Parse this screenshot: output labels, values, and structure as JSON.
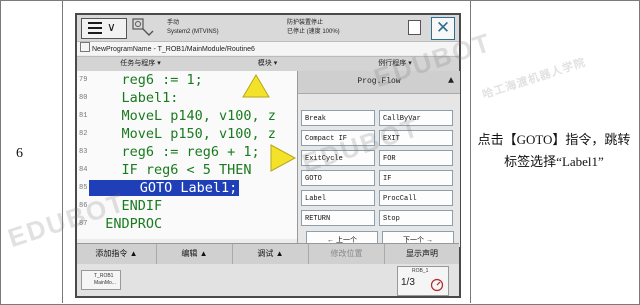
{
  "document": {
    "step_number": "6",
    "description": "点击【GOTO】指令，跳转标签选择“Label1”"
  },
  "pendant": {
    "status": {
      "mode": "手动",
      "system": "System2 (MTVINS)",
      "guard_state": "防护装置停止",
      "run_state": "已停止 (速度 100%)"
    },
    "path": "NewProgramName - T_ROB1/MainModule/Routine6",
    "tabs": [
      "任务与程序",
      "模块",
      "例行程序"
    ],
    "code_lines": [
      {
        "num": "79",
        "text": "    reg6 := 1;"
      },
      {
        "num": "80",
        "text": "    Label1:"
      },
      {
        "num": "81",
        "text": "    MoveL p140, v100, z"
      },
      {
        "num": "82",
        "text": "    MoveL p150, v100, z"
      },
      {
        "num": "83",
        "text": "    reg6 := reg6 + 1;"
      },
      {
        "num": "84",
        "text": "    IF reg6 < 5 THEN"
      },
      {
        "num": "85",
        "text": "      GOTO Label1;"
      },
      {
        "num": "86",
        "text": "    ENDIF"
      },
      {
        "num": "87",
        "text": "  ENDPROC"
      }
    ],
    "prog_flow": {
      "title": "Prog.Flow",
      "items": [
        "Break",
        "CallByVar",
        "Compact IF",
        "EXIT",
        "ExitCycle",
        "FOR",
        "GOTO",
        "IF",
        "Label",
        "ProcCall",
        "RETURN",
        "Stop"
      ],
      "prev_label": "← 上一个",
      "next_label": "下一个 →"
    },
    "bottom_tabs": [
      "添加指令",
      "编辑",
      "调试",
      "修改位置",
      "显示声明"
    ],
    "task_chip": "T_ROB1\nMainMo...",
    "rob_chip": {
      "label": "ROB_1",
      "fraction": "1/3"
    }
  },
  "watermarks": [
    "EDUBOT",
    "EDUBOT",
    "EDUBOT",
    "哈工海渡机器人学院"
  ]
}
